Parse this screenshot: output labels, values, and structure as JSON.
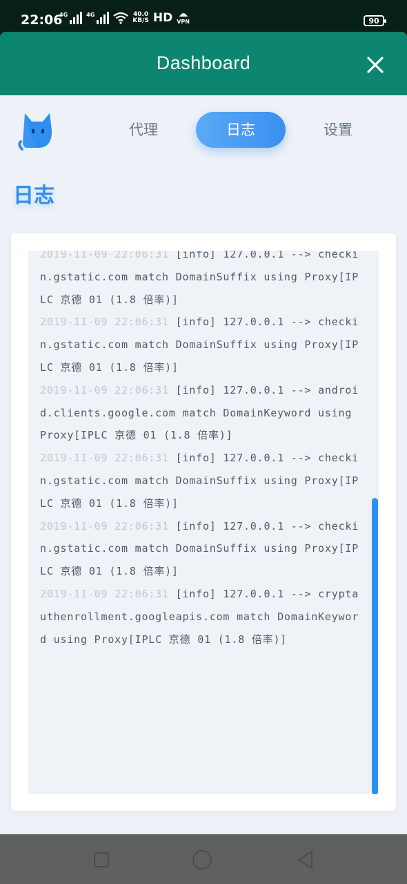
{
  "status_bar": {
    "time": "22:06",
    "net1": "4G",
    "net2": "4G",
    "speed_top": "40.0",
    "speed_bottom": "KB/S",
    "hd": "HD",
    "vpn": "VPN",
    "battery": "90"
  },
  "header": {
    "title": "Dashboard"
  },
  "tabs": [
    {
      "label": "代理",
      "active": false
    },
    {
      "label": "日志",
      "active": true
    },
    {
      "label": "设置",
      "active": false
    }
  ],
  "page_title": "日志",
  "logs": [
    {
      "time": "2019-11-09 22:06:31",
      "text": "[info] 127.0.0.1 --> checkin.gstatic.com match DomainSuffix using Proxy[IPLC 京德 01 (1.8 倍率)]"
    },
    {
      "time": "2019-11-09 22:06:31",
      "text": "[info] 127.0.0.1 --> checkin.gstatic.com match DomainSuffix using Proxy[IPLC 京德 01 (1.8 倍率)]"
    },
    {
      "time": "2019-11-09 22:06:31",
      "text": "[info] 127.0.0.1 --> android.clients.google.com match DomainKeyword using Proxy[IPLC 京德 01 (1.8 倍率)]"
    },
    {
      "time": "2019-11-09 22:06:31",
      "text": "[info] 127.0.0.1 --> checkin.gstatic.com match DomainSuffix using Proxy[IPLC 京德 01 (1.8 倍率)]"
    },
    {
      "time": "2019-11-09 22:06:31",
      "text": "[info] 127.0.0.1 --> checkin.gstatic.com match DomainSuffix using Proxy[IPLC 京德 01 (1.8 倍率)]"
    },
    {
      "time": "2019-11-09 22:06:31",
      "text": "[info] 127.0.0.1 --> cryptauthenrollment.googleapis.com match DomainKeyword using Proxy[IPLC 京德 01 (1.8 倍率)]"
    }
  ],
  "colors": {
    "header": "#0c8670",
    "accent": "#2f8ff0",
    "background": "#eef2f8",
    "log_time": "#c0c7d1",
    "log_text": "#505a66"
  },
  "icons": {
    "close": "close-icon",
    "logo": "cat-logo-icon",
    "nav_back": "square-icon",
    "nav_home": "circle-icon",
    "nav_recent": "triangle-icon"
  }
}
